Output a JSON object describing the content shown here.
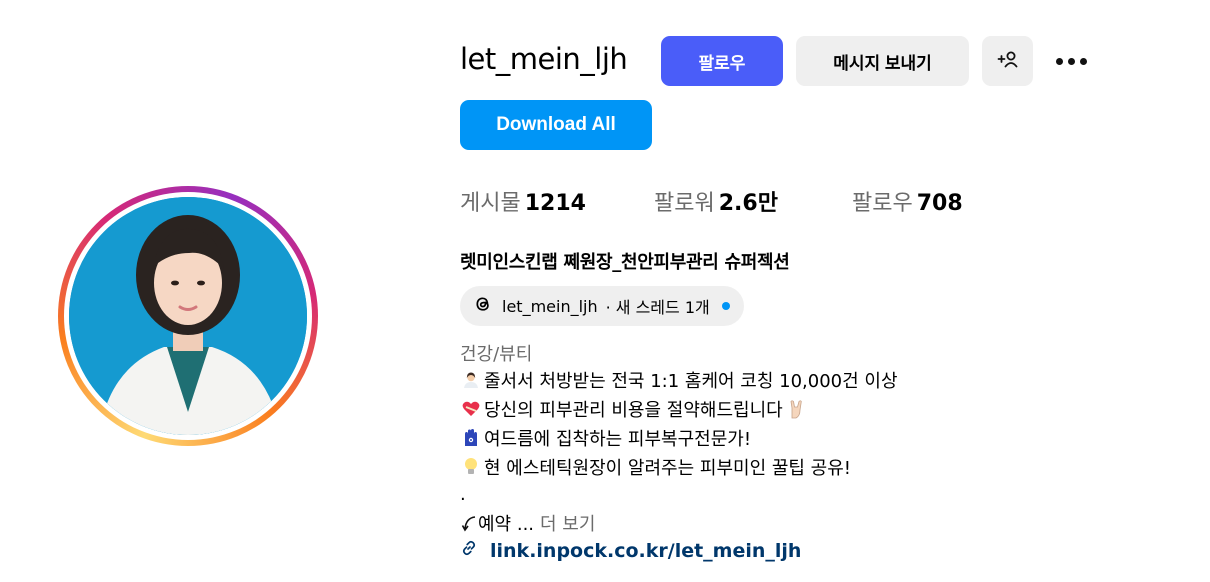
{
  "profile": {
    "username": "let_mein_ljh",
    "follow_label": "팔로우",
    "message_label": "메시지 보내기",
    "download_label": "Download All"
  },
  "stats": {
    "posts_label": "게시물",
    "posts_value": "1214",
    "followers_label": "팔로워",
    "followers_value": "2.6만",
    "following_label": "팔로우",
    "following_value": "708"
  },
  "bio": {
    "full_name": "렛미인스킨랩 쩨원장_천안피부관리 슈퍼젝션",
    "threads_handle": "let_mein_ljh",
    "threads_badge": "· 새 스레드 1개",
    "category": "건강/뷰티",
    "lines": [
      "줄서서 처방받는 전국 1:1 홈케어 코칭 10,000건 이상",
      "당신의 피부관리 비용을 절약해드립니다",
      "여드름에 집착하는 피부복구전문가!",
      "현 에스테틱원장이 알려주는 피부미인 꿀팁 공유!",
      ".",
      "예약 ..."
    ],
    "line_icons": [
      "doctor-emoji",
      "mending-heart-emoji",
      "hamsa-emoji",
      "light-bulb-emoji",
      "",
      "curved-arrow"
    ],
    "more_label": "더 보기",
    "link": "link.inpock.co.kr/let_mein_ljh"
  },
  "colors": {
    "follow_button": "#4a5df9",
    "download_button": "#0095f6",
    "secondary_button": "#efefef",
    "link_text": "#00376b",
    "avatar_background": "#159ad0"
  }
}
